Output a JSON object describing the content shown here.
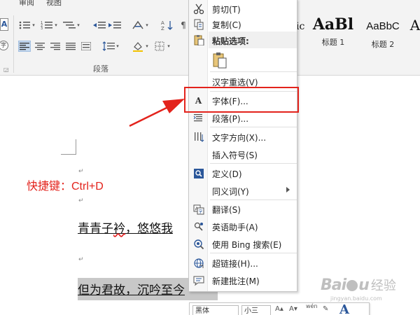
{
  "ribbon": {
    "tabs": [
      "审阅",
      "视图"
    ],
    "group_label": "段落",
    "styles": [
      {
        "sample": "ic",
        "name": ""
      },
      {
        "sample": "AaBl",
        "name": "标题 1"
      },
      {
        "sample": "AaBbC",
        "name": "标题 2"
      },
      {
        "sample": "A",
        "name": ""
      }
    ]
  },
  "document": {
    "shortcut": "快捷键：Ctrl+D",
    "line1_a": "青青子",
    "line1_err": "衿",
    "line1_b": "，悠悠我",
    "line2": "但为君故，沉吟至今",
    "para_mark": "↵"
  },
  "context_menu": {
    "items": [
      {
        "label": "剪切(T)",
        "icon": "scissors-icon"
      },
      {
        "label": "复制(C)",
        "icon": "copy-icon"
      },
      {
        "label": "粘贴选项:",
        "icon": "clipboard-icon"
      },
      {
        "label": "汉字重选(V)",
        "icon": ""
      },
      {
        "label": "字体(F)...",
        "icon": "font-icon",
        "icon_text": "A"
      },
      {
        "label": "段落(P)...",
        "icon": "paragraph-icon"
      },
      {
        "label": "文字方向(X)...",
        "icon": "text-direction-icon"
      },
      {
        "label": "插入符号(S)",
        "icon": ""
      },
      {
        "label": "定义(D)",
        "icon": "define-icon"
      },
      {
        "label": "同义词(Y)",
        "icon": ""
      },
      {
        "label": "翻译(S)",
        "icon": "translate-icon"
      },
      {
        "label": "英语助手(A)",
        "icon": "english-assistant-icon"
      },
      {
        "label": "使用 Bing 搜索(E)",
        "icon": "bing-search-icon"
      },
      {
        "label": "超链接(H)...",
        "icon": "hyperlink-icon"
      },
      {
        "label": "新建批注(M)",
        "icon": "new-comment-icon"
      }
    ]
  },
  "mini_toolbar": {
    "font": "黑体",
    "size": "小三",
    "phonetic": "wén"
  },
  "watermark": {
    "brand": "Bai",
    "brand_end": "u",
    "suffix": "经验",
    "url": "jingyan.baidu.com"
  },
  "colors": {
    "annotation_red": "#e3231c",
    "accent_blue": "#2b579a"
  }
}
